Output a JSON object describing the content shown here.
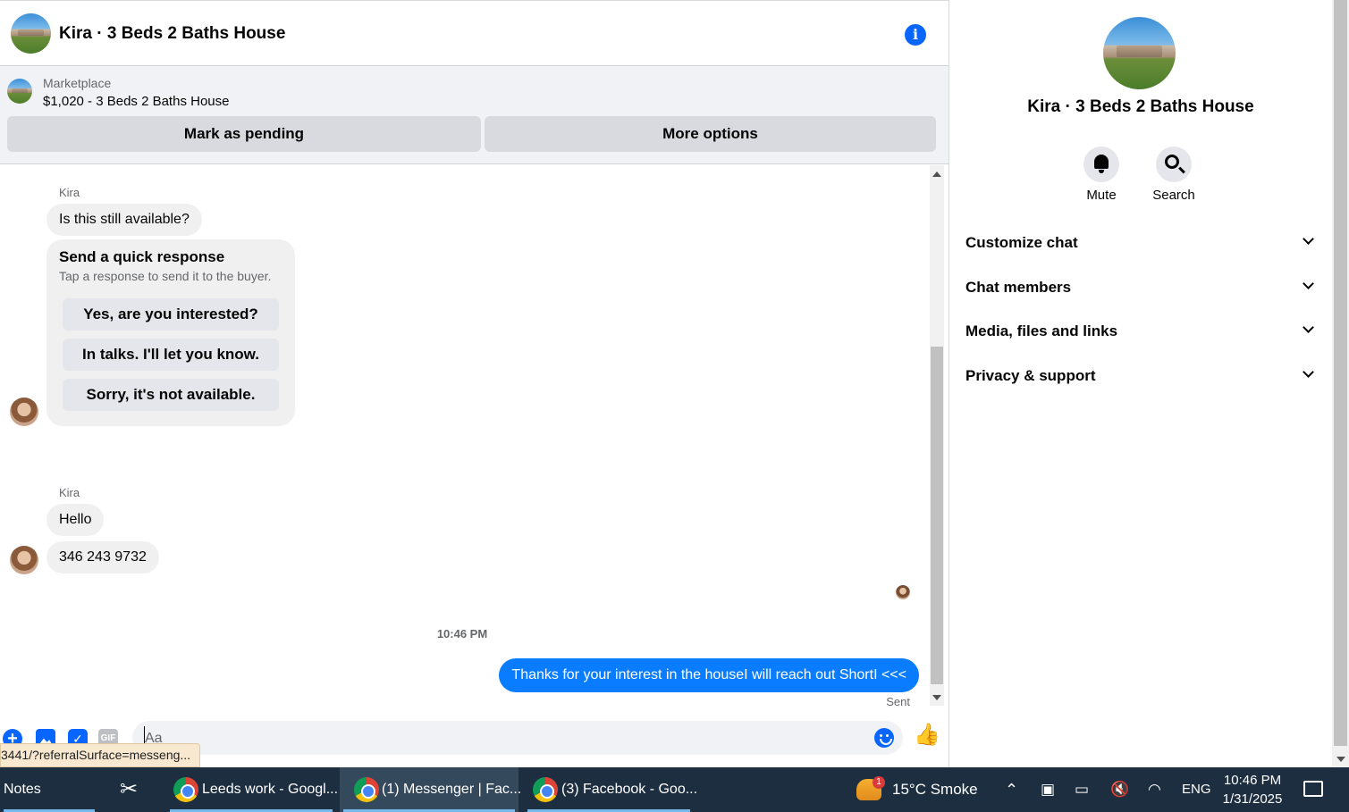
{
  "header": {
    "title": "Kira · 3 Beds 2 Baths House",
    "info_icon": "info-icon"
  },
  "marketplace": {
    "label": "Marketplace",
    "item": "$1,020 - 3 Beds 2 Baths House",
    "mark_pending_label": "Mark as pending",
    "more_options_label": "More options"
  },
  "messages": {
    "group1": {
      "sender": "Kira",
      "text": "Is this still available?",
      "quick_response": {
        "title": "Send a quick response",
        "subtitle": "Tap a response to send it to the buyer.",
        "options": [
          "Yes, are you interested?",
          "In talks. I'll let you know.",
          "Sorry, it's not available."
        ]
      }
    },
    "group2": {
      "sender": "Kira",
      "texts": [
        "Hello",
        "346 243 9732"
      ]
    },
    "timestamp": "10:46 PM",
    "outgoing": "Thanks for your interest in the houseI will reach out ShortI <<<",
    "status": "Sent"
  },
  "composer": {
    "placeholder": "Aa",
    "status_url": "3441/?referralSurface=messeng...",
    "gif_label": "GIF"
  },
  "panel": {
    "title": "Kira · 3 Beds 2 Baths House",
    "actions": [
      {
        "label": "Mute"
      },
      {
        "label": "Search"
      }
    ],
    "sections": [
      "Customize chat",
      "Chat members",
      "Media, files and links",
      "Privacy & support"
    ]
  },
  "taskbar": {
    "items": [
      {
        "label": "Notes"
      },
      {
        "label": "Leeds work - Googl..."
      },
      {
        "label": "(1) Messenger | Fac..."
      },
      {
        "label": "(3) Facebook - Goo..."
      }
    ],
    "weather_badge": "1",
    "weather": "15°C  Smoke",
    "language": "ENG",
    "time": "10:46 PM",
    "date": "1/31/2025"
  },
  "colors": {
    "accent": "#0866ff",
    "outgoing_bubble": "#0a7cff",
    "taskbar": "#1c2e3f"
  }
}
